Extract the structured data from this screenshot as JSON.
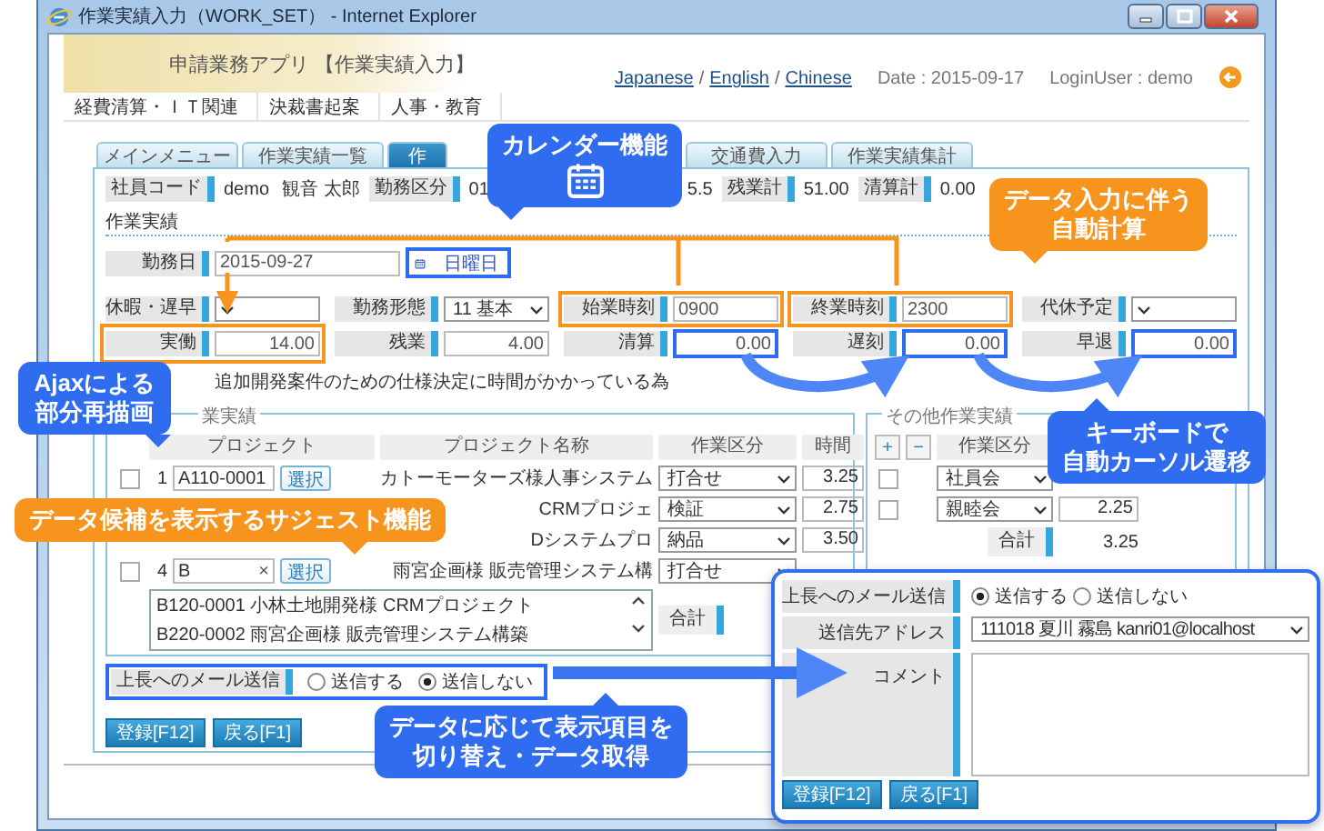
{
  "window": {
    "title": "作業実績入力（WORK_SET） - Internet Explorer"
  },
  "header": {
    "app_title": "申請業務アプリ 【作業実績入力】",
    "languages": [
      "Japanese",
      "English",
      "Chinese"
    ],
    "language_separator": "/",
    "date": "Date : 2015-09-17",
    "login_user": "LoginUser : demo"
  },
  "menu": [
    "経費清算・ＩＴ関連",
    "決裁書起案",
    "人事・教育"
  ],
  "tabs": [
    {
      "label": "メインメニュー",
      "selected": false
    },
    {
      "label": "作業実績一覧",
      "selected": false
    },
    {
      "label": "作",
      "selected": true
    },
    {
      "label": "交通費入力",
      "selected": false
    },
    {
      "label": "作業実績集計",
      "selected": false
    }
  ],
  "summary_left": [
    {
      "kind": "label",
      "text": "社員コード"
    },
    {
      "kind": "text",
      "text": "demo"
    },
    {
      "kind": "text",
      "text": "観音 太郎"
    },
    {
      "kind": "label",
      "text": "勤務区分"
    },
    {
      "kind": "text",
      "text": "01"
    }
  ],
  "summary_right": [
    {
      "kind": "text",
      "text": "5.5"
    },
    {
      "kind": "label",
      "text": "残業計"
    },
    {
      "kind": "text",
      "text": "51.00"
    },
    {
      "kind": "label",
      "text": "清算計"
    },
    {
      "kind": "text",
      "text": "0.00"
    }
  ],
  "section_title": "作業実績",
  "work_date": {
    "label": "勤務日",
    "value": "2015-09-27",
    "weekday": "日曜日",
    "framed": true
  },
  "form_rows": [
    [
      {
        "label": "休暇・遅早",
        "kind": "select"
      },
      {
        "label": "勤務形態",
        "kind": "select",
        "value": "11 基本"
      },
      {
        "label": "始業時刻",
        "kind": "input",
        "value": "0900",
        "framed_cell": true
      },
      {
        "label": "終業時刻",
        "kind": "input",
        "value": "2300",
        "framed_cell": true
      },
      {
        "label": "代休予定",
        "kind": "select"
      }
    ],
    [
      {
        "label": "実働",
        "kind": "number",
        "value": "14.00",
        "framed_cell": true
      },
      {
        "label": "残業",
        "kind": "number",
        "value": "4.00"
      },
      {
        "label": "清算",
        "kind": "number",
        "value": "0.00",
        "framed_field": true
      },
      {
        "label": "遅刻",
        "kind": "number",
        "value": "0.00",
        "framed_field": true
      },
      {
        "label": "早退",
        "kind": "number",
        "value": "0.00",
        "framed_field": true
      }
    ]
  ],
  "reason": "追加開発案件のための仕様決定に時間がかかっている為",
  "work_table": {
    "legend": "業実績",
    "columns": [
      "プロジェクト",
      "プロジェクト名称",
      "作業区分",
      "時間"
    ],
    "rows": [
      {
        "checked": false,
        "no": "1",
        "code": "A110-0001",
        "pick": "選択",
        "name": "カトーモーターズ様人事システム",
        "category": "打合せ",
        "hours": "3.25"
      },
      {
        "name": "CRMプロジェ",
        "category": "検証",
        "hours": "2.75"
      },
      {
        "name": "Dシステムプロ",
        "category": "納品",
        "hours": "3.50"
      },
      {
        "checked": false,
        "no": "4",
        "code": "B",
        "clear": "×",
        "pick": "選択",
        "name": "雨宮企画様 販売管理システム構",
        "category": "打合せ"
      }
    ],
    "suggestions": [
      "B120-0001 小林土地開発様 CRMプロジェクト",
      "B220-0002 雨宮企画様 販売管理システム構築"
    ],
    "total_label": "合計"
  },
  "other_table": {
    "legend": "その他作業実績",
    "add": "+",
    "remove": "−",
    "column": "作業区分",
    "rows": [
      {
        "checked": false,
        "category": "社員会"
      },
      {
        "checked": false,
        "category": "親睦会",
        "hours": "2.25"
      }
    ],
    "total_label": "合計",
    "total": "3.25"
  },
  "mail": {
    "label": "上長へのメール送信",
    "framed": true,
    "options": [
      {
        "label": "送信する",
        "selected": false
      },
      {
        "label": "送信しない",
        "selected": true
      }
    ]
  },
  "buttons": [
    "登録[F12]",
    "戻る[F1]"
  ],
  "popup": {
    "mail_label": "上長へのメール送信",
    "options": [
      {
        "label": "送信する",
        "selected": true
      },
      {
        "label": "送信しない",
        "selected": false
      }
    ],
    "address_label": "送信先アドレス",
    "address": "111018 夏川 霧島 kanri01@localhost",
    "comment_label": "コメント",
    "buttons": [
      "登録[F12]",
      "戻る[F1]"
    ]
  },
  "callouts": [
    {
      "lines": [
        "カレンダー機能"
      ],
      "color": "#2f6cf0"
    },
    {
      "lines": [
        "データ入力に伴う",
        "自動計算"
      ],
      "color": "#f7941d"
    },
    {
      "lines": [
        "Ajaxによる",
        "部分再描画"
      ],
      "color": "#2f6cf0"
    },
    {
      "lines": [
        "データ候補を表示するサジェスト機能"
      ],
      "color": "#f7941d"
    },
    {
      "lines": [
        "キーボードで",
        "自動カーソル遷移"
      ],
      "color": "#2f6cf0"
    },
    {
      "lines": [
        "データに応じて表示項目を",
        "切り替え・データ取得"
      ],
      "color": "#2f6cf0"
    }
  ]
}
